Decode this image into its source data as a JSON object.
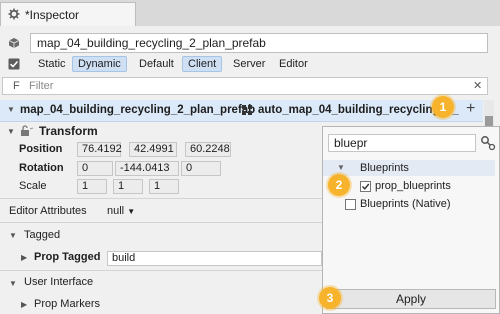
{
  "tab": {
    "title": "*Inspector"
  },
  "entity": {
    "name": "map_04_building_recycling_2_plan_prefab"
  },
  "filters": [
    {
      "label": "Static",
      "active": false
    },
    {
      "label": "Dynamic",
      "active": true
    },
    {
      "label": "Default",
      "active": false
    },
    {
      "label": "Client",
      "active": true
    },
    {
      "label": "Server",
      "active": false
    },
    {
      "label": "Editor",
      "active": false
    }
  ],
  "filter_box": {
    "prefix": "F",
    "placeholder": "Filter"
  },
  "header": {
    "left": "map_04_building_recycling_2_plan_prefab",
    "right": "auto_map_04_building_recycling_2_"
  },
  "transform": {
    "title": "Transform",
    "position": {
      "label": "Position",
      "x": "76.4192",
      "y": "42.4991",
      "z": "60.2248"
    },
    "rotation": {
      "label": "Rotation",
      "x": "0",
      "y": "-144.0413",
      "z": "0"
    },
    "scale": {
      "label": "Scale",
      "x": "1",
      "y": "1",
      "z": "1"
    }
  },
  "editor_attributes": {
    "label": "Editor Attributes",
    "value": "null"
  },
  "tagged": {
    "title": "Tagged",
    "prop_label": "Prop Tagged",
    "prop_value": "build"
  },
  "ui": {
    "title": "User Interface",
    "item": "Prop Markers"
  },
  "popup": {
    "search": "bluepr",
    "group": "Blueprints",
    "items": [
      {
        "label": "prop_blueprints",
        "checked": true
      },
      {
        "label": "Blueprints (Native)",
        "checked": false
      }
    ],
    "apply": "Apply"
  },
  "badges": [
    "1",
    "2",
    "3"
  ],
  "colors": {
    "accent": "#f7b32b",
    "header_bg": "#dce9f8",
    "active_pill": "#cfe0f5"
  }
}
